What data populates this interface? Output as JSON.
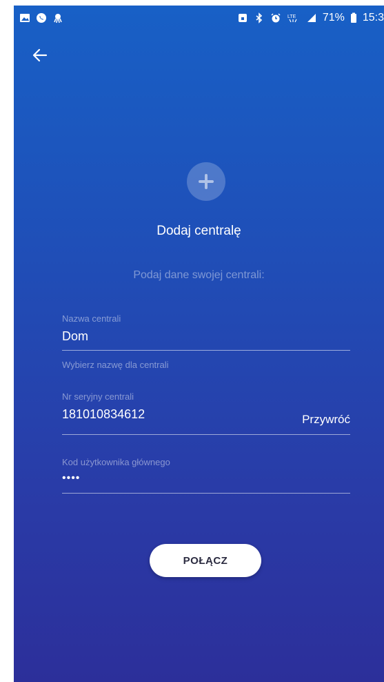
{
  "status_bar": {
    "left_icons": [
      "gallery-icon",
      "whatsapp-icon",
      "octopus-icon"
    ],
    "right_icons": [
      "lock-icon",
      "bluetooth-icon",
      "alarm-icon",
      "lte-icon",
      "signal-icon"
    ],
    "battery": "71%",
    "time": "15:3"
  },
  "header": {
    "back_icon": "arrow-left-icon"
  },
  "hero": {
    "icon": "plus-icon",
    "title": "Dodaj centralę",
    "subtitle": "Podaj dane swojej centrali:"
  },
  "form": {
    "name": {
      "label": "Nazwa centrali",
      "value": "Dom",
      "helper": "Wybierz nazwę dla centrali"
    },
    "serial": {
      "label": "Nr seryjny centrali",
      "value": "181010834612",
      "action": "Przywróć"
    },
    "code": {
      "label": "Kod użytkownika głównego",
      "value": "••••"
    }
  },
  "actions": {
    "connect": "POŁĄCZ"
  },
  "colors": {
    "gradient_top": "#1860c6",
    "gradient_bottom": "#2c2f9a",
    "button_bg": "#ffffff"
  }
}
